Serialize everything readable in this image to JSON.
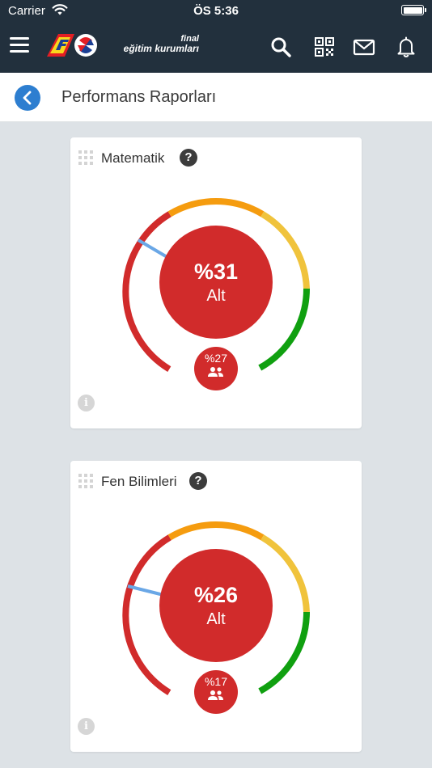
{
  "status_bar": {
    "carrier": "Carrier",
    "time": "ÖS 5:36"
  },
  "nav": {
    "brand_line1": "final",
    "brand_line2": "eğitim kurumları",
    "icons": [
      "menu-icon",
      "search-icon",
      "qr-code-icon",
      "mail-icon",
      "bell-icon"
    ]
  },
  "page": {
    "title": "Performans Raporları"
  },
  "colors": {
    "nav_bg": "#22303d",
    "accent_blue": "#2d7ed0",
    "red": "#d12b2b",
    "orange": "#f59c0f",
    "yellow": "#f0c33c",
    "green": "#10a010"
  },
  "cards": [
    {
      "title": "Matematik",
      "score_text": "%31",
      "score_value": 31,
      "level": "Alt",
      "group_text": "%27",
      "group_value": 27
    },
    {
      "title": "Fen Bilimleri",
      "score_text": "%26",
      "score_value": 26,
      "level": "Alt",
      "group_text": "%17",
      "group_value": 17
    }
  ]
}
